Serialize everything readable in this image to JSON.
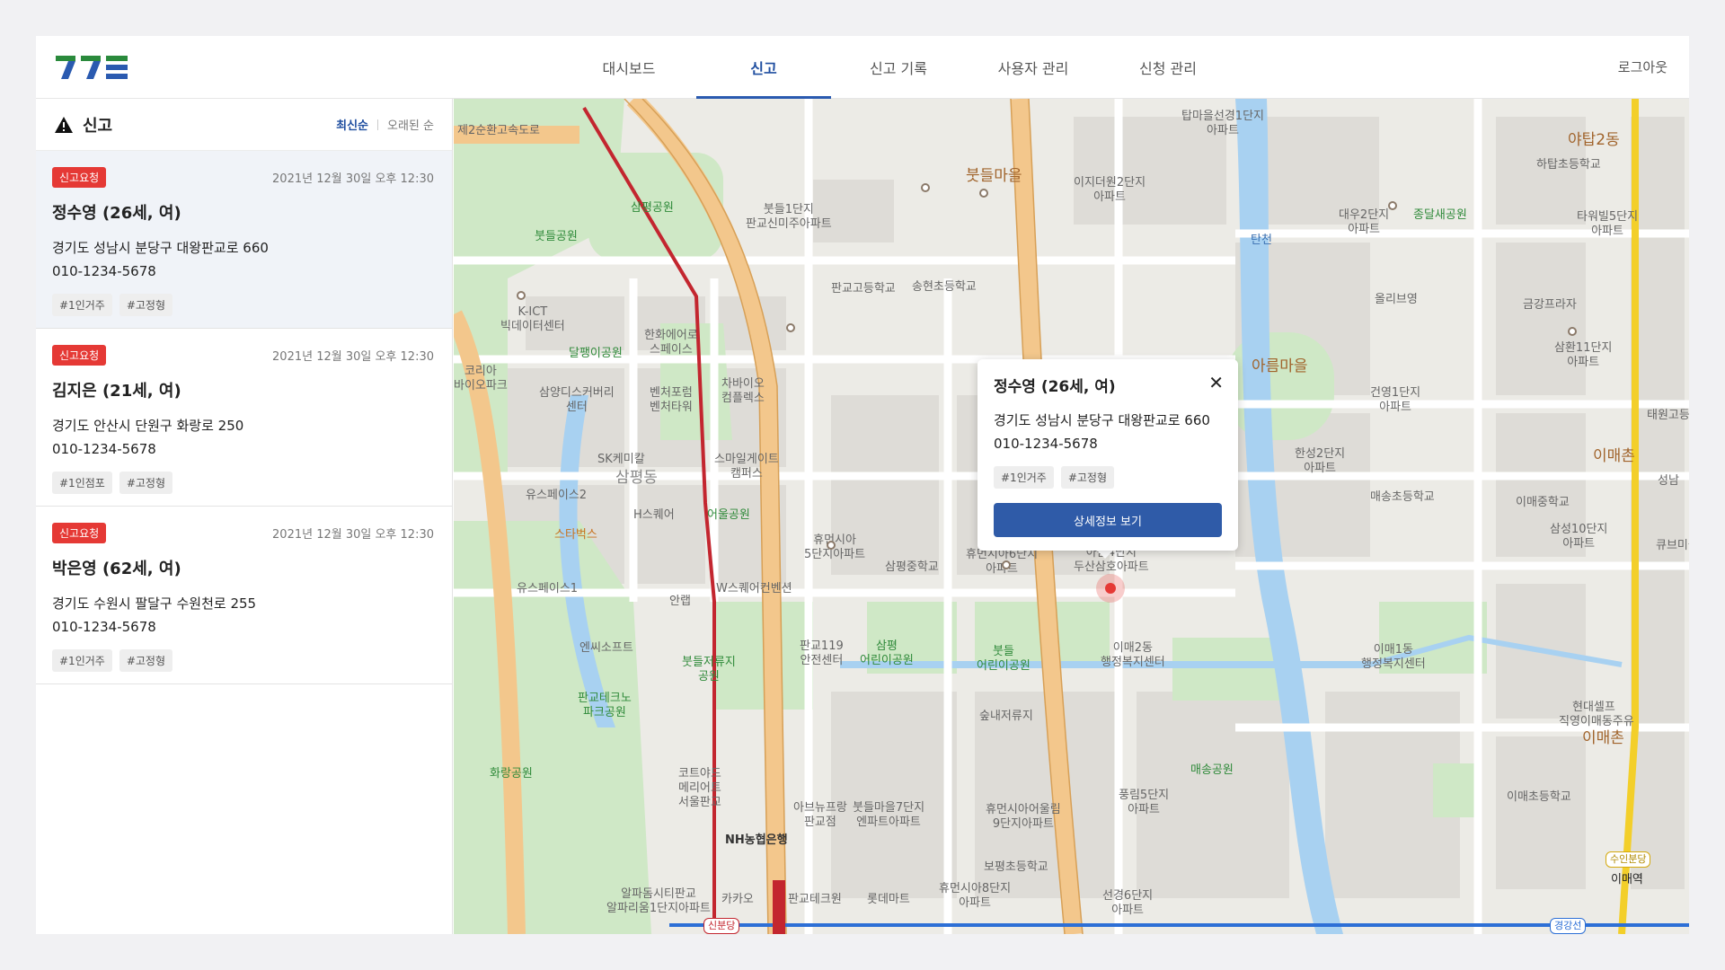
{
  "nav": {
    "tabs": [
      "대시보드",
      "신고",
      "신고 기록",
      "사용자 관리",
      "신청 관리"
    ],
    "active": "신고",
    "logout": "로그아웃"
  },
  "sidebar": {
    "title": "신고",
    "sort_latest": "최신순",
    "sort_oldest": "오래된 순",
    "reports": [
      {
        "badge": "신고요청",
        "date": "2021년 12월 30일 오후 12:30",
        "name": "정수영 (26세, 여)",
        "address": "경기도 성남시 분당구 대왕판교로 660",
        "phone": "010-1234-5678",
        "tags": [
          "#1인거주",
          "#고정형"
        ]
      },
      {
        "badge": "신고요청",
        "date": "2021년 12월 30일 오후 12:30",
        "name": "김지은 (21세, 여)",
        "address": "경기도 안산시 단원구 화랑로 250",
        "phone": "010-1234-5678",
        "tags": [
          "#1인점포",
          "#고정형"
        ]
      },
      {
        "badge": "신고요청",
        "date": "2021년 12월 30일 오후 12:30",
        "name": "박은영 (62세, 여)",
        "address": "경기도 수원시 팔달구 수원천로 255",
        "phone": "010-1234-5678",
        "tags": [
          "#1인거주",
          "#고정형"
        ]
      }
    ]
  },
  "popup": {
    "name": "정수영 (26세, 여)",
    "address": "경기도 성남시 분당구 대왕판교로 660",
    "phone": "010-1234-5678",
    "tags": [
      "#1인거주",
      "#고정형"
    ],
    "button": "상세정보 보기"
  },
  "map_labels": {
    "l1": "제2순환고속도로",
    "l2": "탑마을선경1단지\n아파트",
    "l3": "야탑2동",
    "l4": "하탑초등학교",
    "l5": "붓들마을",
    "l6": "이지더원2단지\n아파트",
    "l7": "대우2단지\n아파트",
    "l8": "종달새공원",
    "l9": "타워빌5단지\n아파트",
    "l10": "삼평공원",
    "l11": "붓들1단지\n판교신미주아파트",
    "l12": "붓들공원",
    "l13": "판교고등학교",
    "l14": "송현초등학교",
    "l15": "탄천",
    "l16": "올리브영",
    "l17": "금강프라자",
    "l18": "K-ICT\n빅데이터센터",
    "l19": "한화에어로\n스페이스",
    "l20": "달팽이공원",
    "l21": "차바이오\n컴플렉스",
    "l22": "아름마을",
    "l23": "삼환11단지\n아파트",
    "l24": "코리아\n바이오파크",
    "l25": "삼양디스커버리\n센터",
    "l26": "벤처포럼\n벤처타워",
    "l27": "건영1단지\n아파트",
    "l28": "태원고등",
    "l29": "SK케미칼",
    "l30": "스마일게이트\n캠퍼스",
    "l31": "삼평동",
    "l32": "한성2단지\n아파트",
    "l33": "이매촌",
    "l34": "유스페이스2",
    "l35": "H스퀘어",
    "l36": "어울공원",
    "l37": "매송초등학교",
    "l38": "이매중학교",
    "l39": "성남",
    "l40": "스타벅스",
    "l41": "휴먼시아\n5단지아파트",
    "l42": "삼평중학교",
    "l43": "휴먼시아6단지\n아파트",
    "l44": "아름4단지\n두산삼호아파트",
    "l45": "삼성10단지\n아파트",
    "l46": "유스페이스1",
    "l47": "안랩",
    "l48": "W스퀘어컨벤션",
    "l49": "큐브미술",
    "l50": "엔씨소프트",
    "l51": "판교119\n안전센터",
    "l52": "삼평\n어린이공원",
    "l53": "붓들\n어린이공원",
    "l54": "이매2동\n행정복지센터",
    "l55": "이매1동\n행정복지센터",
    "l56": "붓들저류지\n공원",
    "l57": "판교테크노\n파크공원",
    "l58": "숲내저류지",
    "l59": "현대셀프",
    "l60": "직영이매동주유",
    "l61": "화랑공원",
    "l62": "코트야드\n메리어트\n서울판교",
    "l63": "아브뉴프랑\n판교점",
    "l64": "붓들마을7단지\n엔파트아파트",
    "l65": "휴먼시아어울림\n9단지아파트",
    "l66": "매송공원",
    "l67": "풍림5단지\n아파트",
    "l68": "이매초등학교",
    "l69": "NH농협은행",
    "l70": "보평초등학교",
    "l71": "알파돔시티판교\n알파리움1단지아파트",
    "l72": "카카오",
    "l73": "판교테크원",
    "l74": "롯데마트",
    "l75": "휴먼시아8단지\n아파트",
    "l76": "선경6단지\n아파트",
    "l77": "이매역",
    "l78": "신분당",
    "l79": "수인분당",
    "l80": "경강선",
    "l81": "이매촌"
  },
  "colors": {
    "accent": "#2f5ba8",
    "badge": "#e53935",
    "map_bg": "#ecebe6",
    "road_main": "#f3c78c",
    "subway_red": "#c3262f",
    "river": "#a8d1f1",
    "park": "#cfe8c6",
    "subway_yellow": "#f3cf2a"
  }
}
